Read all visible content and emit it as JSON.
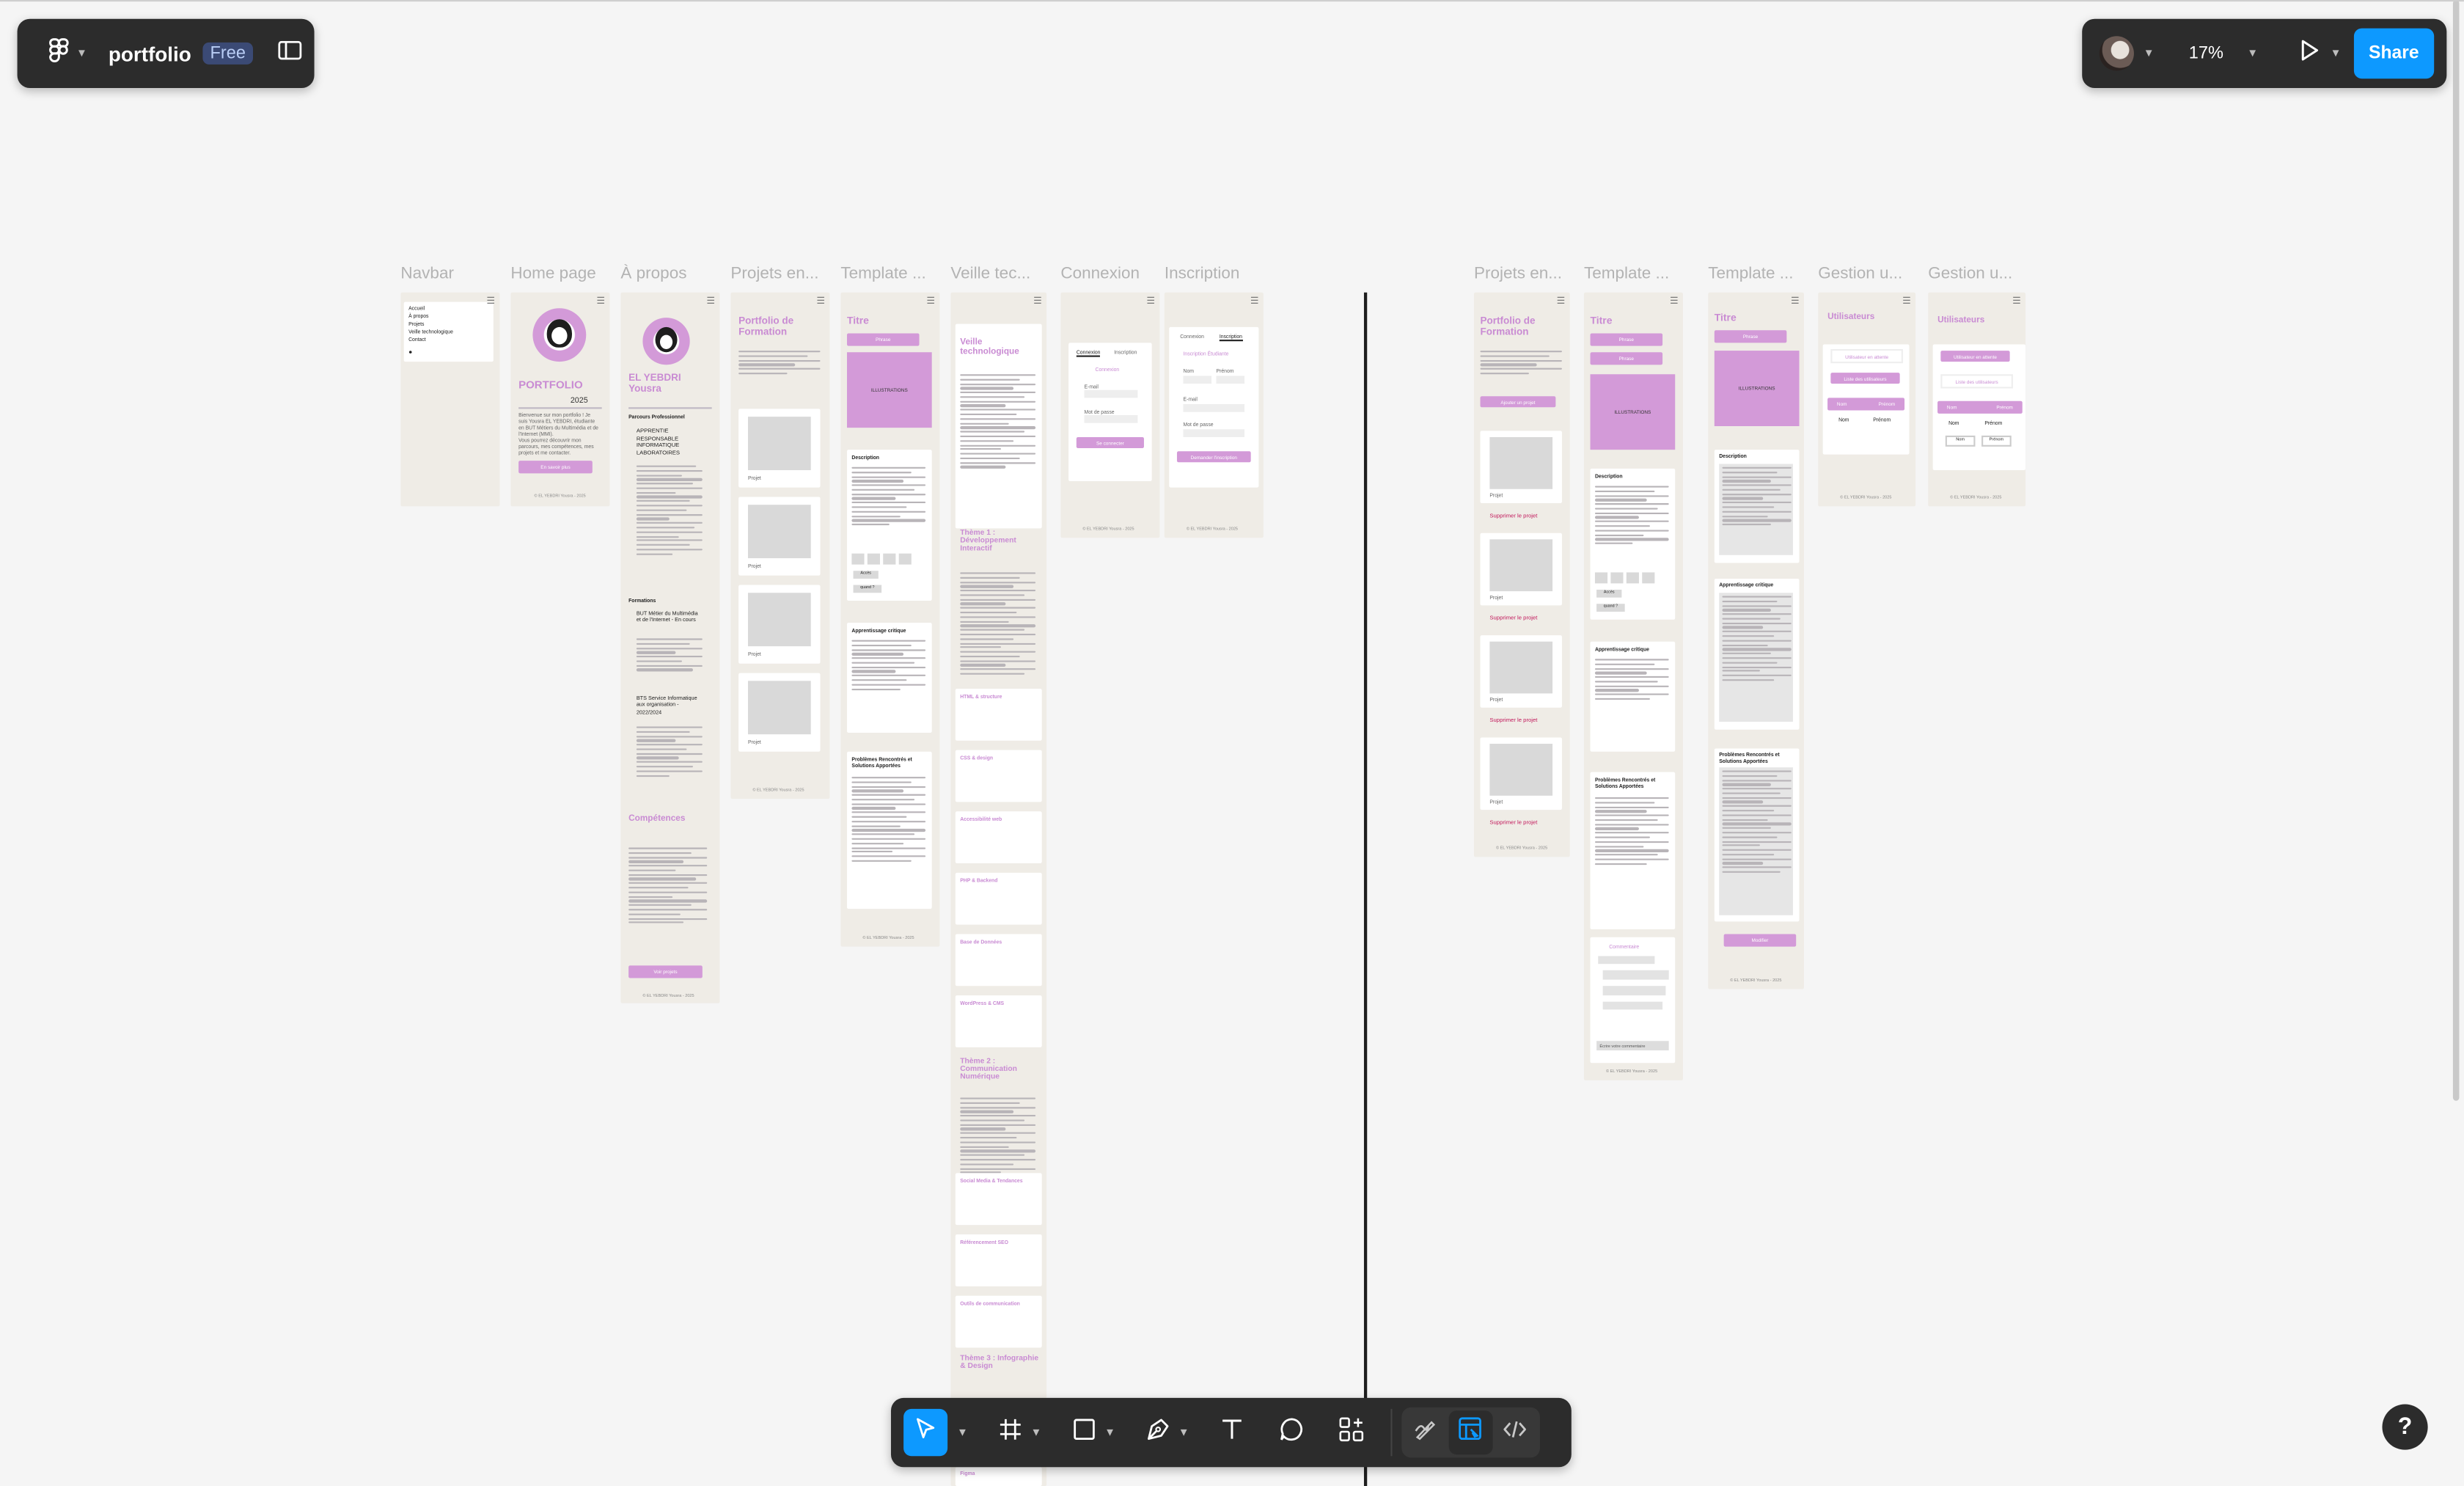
{
  "header": {
    "file_name": "portfolio",
    "plan_badge": "Free",
    "zoom": "17%",
    "share_label": "Share"
  },
  "frames": {
    "titles": [
      "Navbar",
      "Home page",
      "À propos",
      "Projets en...",
      "Template ...",
      "Veille tec...",
      "Connexion",
      "Inscription",
      "Projets en...",
      "Template ...",
      "Template ...",
      "Gestion u...",
      "Gestion u..."
    ]
  },
  "navbar": {
    "items": [
      "Accueil",
      "À propos",
      "Projets",
      "Veille technologique",
      "Contact"
    ]
  },
  "home": {
    "title": "PORTFOLIO",
    "year": "2025",
    "intro": "Bienvenue sur mon portfolio ! Je suis Yousra EL YEBDRI, étudiante en BUT Métiers du Multimédia et de l'Internet (MMI).",
    "intro2": "Vous pourrez découvrir mon parcours, mes compétences, mes projets et me contacter.",
    "button": "En savoir plus",
    "footer": "© EL YEBDRI Yousra - 2025"
  },
  "about": {
    "name": "EL YEBDRI Yousra",
    "section_parcours": "Parcours Professionnel",
    "job1": "APPRENTIE RESPONSABLE INFORMATIQUE LABORATOIRES",
    "section_formations": "Formations",
    "formation1": "BUT Métier du Multimédia et de l'Internet - En cours",
    "formation2": "BTS Service Informatique aux organisation - 2022/2024",
    "section_competences": "Compétences",
    "button": "Voir projets",
    "footer": "© EL YEBDRI Yousra - 2025"
  },
  "projects": {
    "title": "Portfolio de Formation",
    "item_label": "Projet",
    "delete_label": "Supprimer le projet",
    "add_label": "Ajouter un projet",
    "footer": "© EL YEBDRI Yousra - 2025"
  },
  "template": {
    "title": "Titre",
    "tag": "Phrase",
    "illustrations": "ILLUSTRATIONS",
    "description": "Description",
    "apprentissage": "Apprentissage critique",
    "problemes": "Problèmes Rencontrés et Solutions Apportées",
    "commentaire": "Commentaire",
    "comment_placeholder": "Écrire votre commentaire",
    "modifier": "Modifier",
    "btn_a": "Accès",
    "btn_b": "quand ?",
    "footer": "© EL YEBDRI Yousra - 2025"
  },
  "veille": {
    "title": "Veille technologique",
    "theme1": "Thème 1 : Développement Interactif",
    "theme2": "Thème 2 : Communication Numérique",
    "theme3": "Thème 3 : Infographie & Design",
    "topics": [
      "HTML & structure",
      "CSS & design",
      "Accessibilité web",
      "PHP & Backend",
      "Base de Données",
      "WordPress & CMS",
      "Social Media & Tendances",
      "Référencement SEO",
      "Outils de communication",
      "Figma"
    ]
  },
  "auth": {
    "connexion_tab": "Connexion",
    "inscription_tab": "Inscription",
    "connexion_title": "Connexion",
    "inscription_title": "Inscription Étudiante",
    "login_button": "Se connecter",
    "signup_button": "Demander l'inscription",
    "nom": "Nom",
    "prenom": "Prénom",
    "email": "E-mail",
    "password": "Mot de passe",
    "footer": "© EL YEBDRI Yousra - 2025"
  },
  "users": {
    "title": "Utilisateurs",
    "search": "Utilisateur en attente",
    "list": "Liste des utilisateurs",
    "col_nom": "Nom",
    "col_prenom": "Prénom",
    "footer": "© EL YEBDRI Yousra - 2025"
  },
  "colors": {
    "accent": "#d39ad8",
    "share_blue": "#0d99ff",
    "toolbar_bg": "#2c2c2c",
    "canvas_bg": "#f5f5f5",
    "frame_bg": "#efece6"
  },
  "help_label": "?"
}
